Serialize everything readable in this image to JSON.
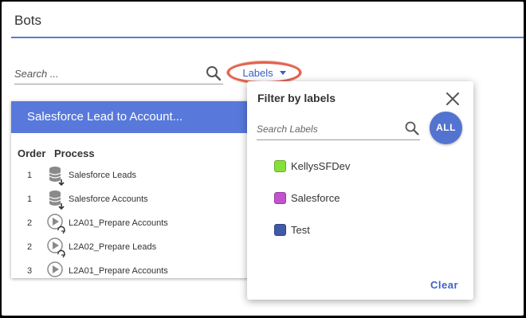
{
  "page": {
    "title": "Bots"
  },
  "search": {
    "placeholder": "Search ..."
  },
  "labels_button": {
    "label": "Labels"
  },
  "card": {
    "title": "Salesforce Lead to Account...",
    "columns": {
      "order": "Order",
      "process": "Process"
    },
    "rows": [
      {
        "order": "1",
        "icon": "database-download-icon",
        "name": "Salesforce Leads"
      },
      {
        "order": "1",
        "icon": "database-download-icon",
        "name": "Salesforce Accounts"
      },
      {
        "order": "2",
        "icon": "play-recycle-icon",
        "name": "L2A01_Prepare Accounts"
      },
      {
        "order": "2",
        "icon": "play-recycle-icon",
        "name": "L2A02_Prepare Leads"
      },
      {
        "order": "3",
        "icon": "play-recycle-icon",
        "name": "L2A01_Prepare Accounts"
      }
    ]
  },
  "filter_popup": {
    "title": "Filter by labels",
    "search_placeholder": "Search Labels",
    "all_label": "ALL",
    "clear_label": "Clear",
    "labels": [
      {
        "name": "KellysSFDev",
        "color": "#86e03a"
      },
      {
        "name": "Salesforce",
        "color": "#c452cf"
      },
      {
        "name": "Test",
        "color": "#3f5aa8"
      }
    ]
  },
  "colors": {
    "accent": "#5879db",
    "highlight_ring": "#e2624f",
    "link": "#3b5cc4"
  }
}
